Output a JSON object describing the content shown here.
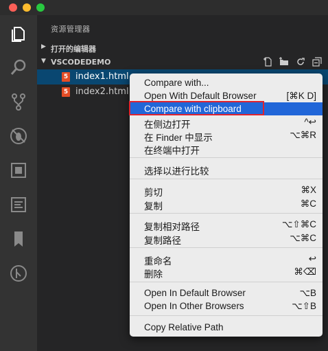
{
  "colors": {
    "traffic_close": "#fc5f57",
    "traffic_min": "#fdbc2e",
    "traffic_max": "#28c840",
    "highlight": "#2166d8",
    "annotation_border": "#e0232e",
    "html_file_icon": "#e44d26"
  },
  "activity_bar": {
    "icons": [
      "files-icon",
      "search-icon",
      "source-control-icon",
      "debug-icon",
      "extensions-icon",
      "preview-icon",
      "bookmark-icon",
      "git-history-icon"
    ]
  },
  "sidebar": {
    "title": "资源管理器",
    "open_editors": "打开的编辑器",
    "workspace": "VSCODEDEMO",
    "files": [
      {
        "name": "index1.html",
        "icon_text": "5"
      },
      {
        "name": "index2.html",
        "icon_text": "5"
      }
    ],
    "header_actions": [
      "new-file-icon",
      "new-folder-icon",
      "refresh-icon",
      "collapse-all-icon"
    ]
  },
  "context_menu": {
    "items": [
      {
        "label": "Compare with...",
        "shortcut": ""
      },
      {
        "label": "Open With Default Browser",
        "shortcut": "[⌘K D]"
      },
      {
        "label": "Compare with clipboard",
        "shortcut": ""
      },
      {
        "label": "在侧边打开",
        "shortcut": "^↩"
      },
      {
        "label": "在 Finder 中显示",
        "shortcut": "⌥⌘R"
      },
      {
        "label": "在终端中打开",
        "shortcut": ""
      },
      {
        "label": "选择以进行比较",
        "shortcut": ""
      },
      {
        "label": "剪切",
        "shortcut": "⌘X"
      },
      {
        "label": "复制",
        "shortcut": "⌘C"
      },
      {
        "label": "复制相对路径",
        "shortcut": "⌥⇧⌘C"
      },
      {
        "label": "复制路径",
        "shortcut": "⌥⌘C"
      },
      {
        "label": "重命名",
        "shortcut": "↩"
      },
      {
        "label": "删除",
        "shortcut": "⌘⌫"
      },
      {
        "label": "Open In Default Browser",
        "shortcut": "⌥B"
      },
      {
        "label": "Open In Other Browsers",
        "shortcut": "⌥⇧B"
      },
      {
        "label": "Copy Relative Path",
        "shortcut": ""
      }
    ]
  }
}
